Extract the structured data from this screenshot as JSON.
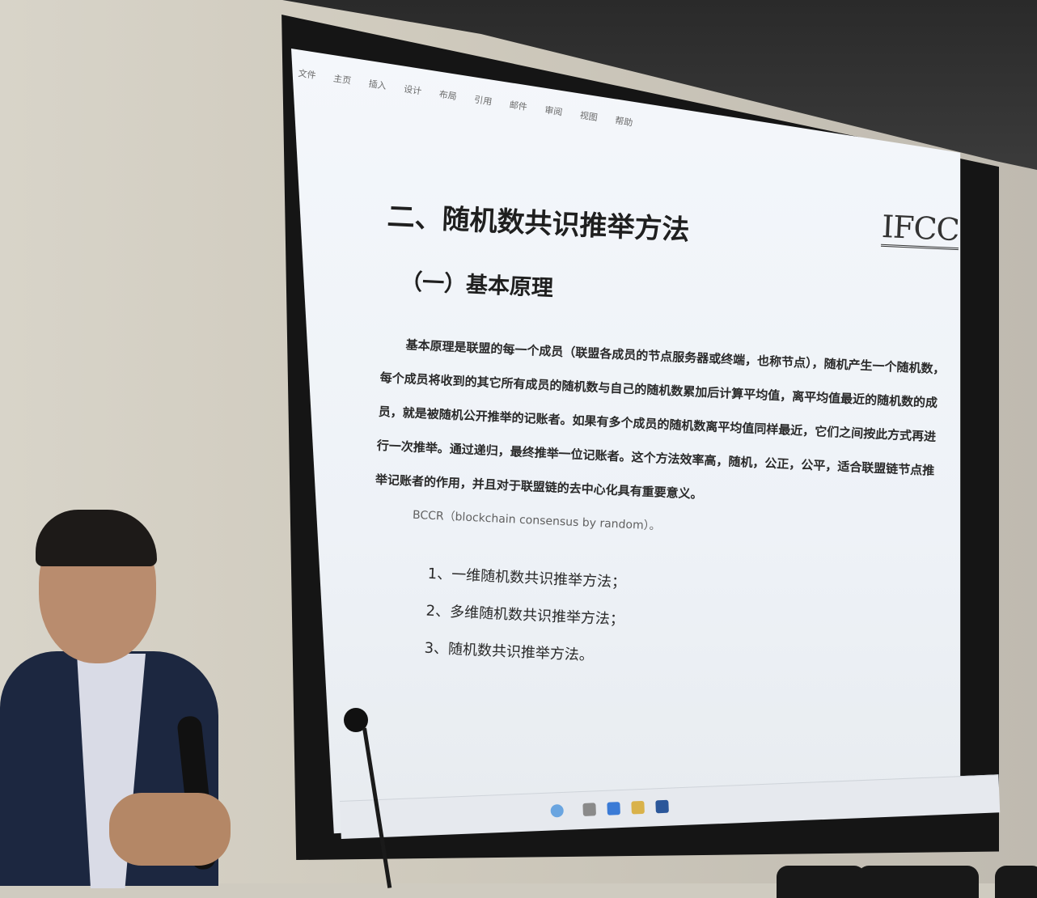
{
  "ribbon_tabs": [
    "文件",
    "主页",
    "插入",
    "设计",
    "布局",
    "引用",
    "邮件",
    "审阅",
    "视图",
    "帮助"
  ],
  "doc": {
    "heading": "二、随机数共识推举方法",
    "subheading": "（一）基本原理",
    "paragraph": "基本原理是联盟的每一个成员（联盟各成员的节点服务器或终端，也称节点），随机产生一个随机数，每个成员将收到的其它所有成员的随机数与自己的随机数累加后计算平均值，离平均值最近的随机数的成员，就是被随机公开推举的记账者。如果有多个成员的随机数离平均值同样最近，它们之间按此方式再进行一次推举。通过递归，最终推举一位记账者。这个方法效率高，随机，公正，公平，适合联盟链节点推举记账者的作用，并且对于联盟链的去中心化具有重要意义。",
    "bccr": "BCCR（blockchain consensus by random）。",
    "list": [
      "1、一维随机数共识推举方法；",
      "2、多维随机数共识推举方法；",
      "3、随机数共识推举方法。"
    ]
  },
  "logo_text": "IFCC",
  "colors": {
    "wall": "#d8d4c9",
    "screen": "#f4f7fb",
    "jacket": "#1c2740"
  }
}
